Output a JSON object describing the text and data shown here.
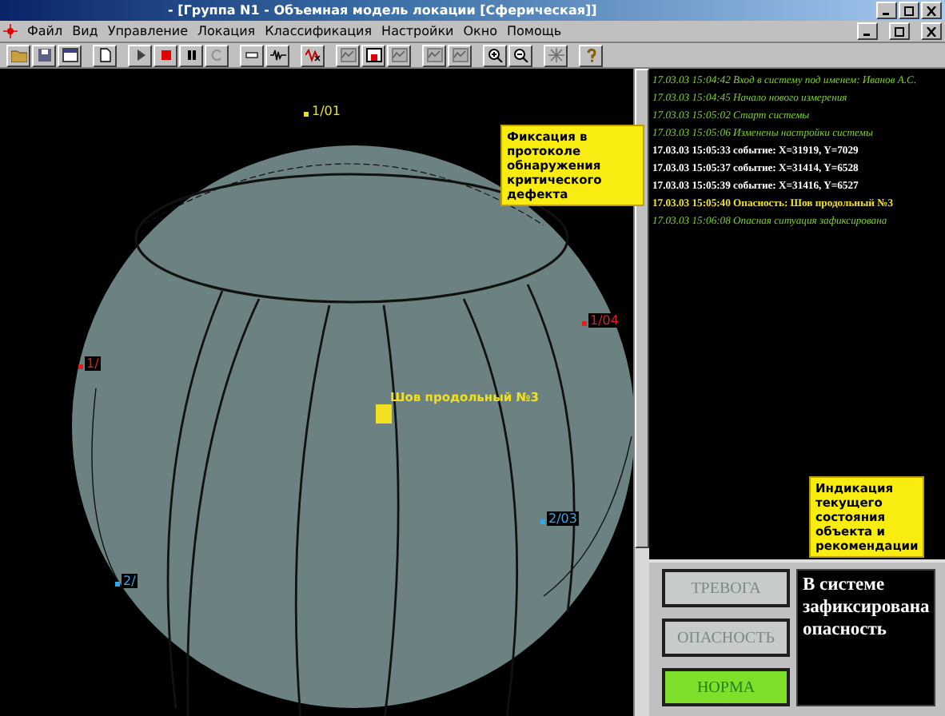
{
  "window": {
    "title": "- [Группа N1 - Объемная модель локации [Сферическая]]"
  },
  "menu": [
    "Файл",
    "Вид",
    "Управление",
    "Локация",
    "Классификация",
    "Настройки",
    "Окно",
    "Помощь"
  ],
  "canvas": {
    "sensors": [
      {
        "label": "1/01",
        "color": "#e8e020"
      },
      {
        "label": "1/04",
        "color": "#e02020"
      },
      {
        "label": "1/",
        "color": "#e02020"
      },
      {
        "label": "2/03",
        "color": "#30a8f0"
      },
      {
        "label": "2/",
        "color": "#30a8f0"
      }
    ],
    "defect": {
      "label": "Шов продольный №3"
    }
  },
  "callouts": [
    "Фиксация в протоколе обнаружения критического дефекта",
    "Индикация текущего состояния объекта и рекомендации"
  ],
  "log": [
    {
      "kind": "info",
      "text": "17.03.03 15:04:42 Вход в систему под именем: Иванов А.С."
    },
    {
      "kind": "info",
      "text": "17.03.03 15:04:45 Начало нового измерения"
    },
    {
      "kind": "info",
      "text": "17.03.03 15:05:02 Старт системы"
    },
    {
      "kind": "info",
      "text": "17.03.03 15:05:06 Изменены настройки системы"
    },
    {
      "kind": "event",
      "text": "17.03.03 15:05:33 событие: X=31919, Y=7029"
    },
    {
      "kind": "event",
      "text": "17.03.03 15:05:37 событие: X=31414, Y=6528"
    },
    {
      "kind": "event",
      "text": "17.03.03 15:05:39 событие: X=31416, Y=6527"
    },
    {
      "kind": "danger",
      "text": "17.03.03 15:05:40 Опасность: Шов продольный №3"
    },
    {
      "kind": "info",
      "text": "17.03.03 15:06:08 Опасная ситуация зафиксирована"
    }
  ],
  "status": {
    "indicators": [
      {
        "kind": "alarm",
        "label": "ТРЕВОГА",
        "lit": false
      },
      {
        "kind": "danger",
        "label": "ОПАСНОСТЬ",
        "lit": false
      },
      {
        "kind": "norm",
        "label": "НОРМА",
        "lit": true
      }
    ],
    "message": "В системе зафиксирована опасность"
  }
}
